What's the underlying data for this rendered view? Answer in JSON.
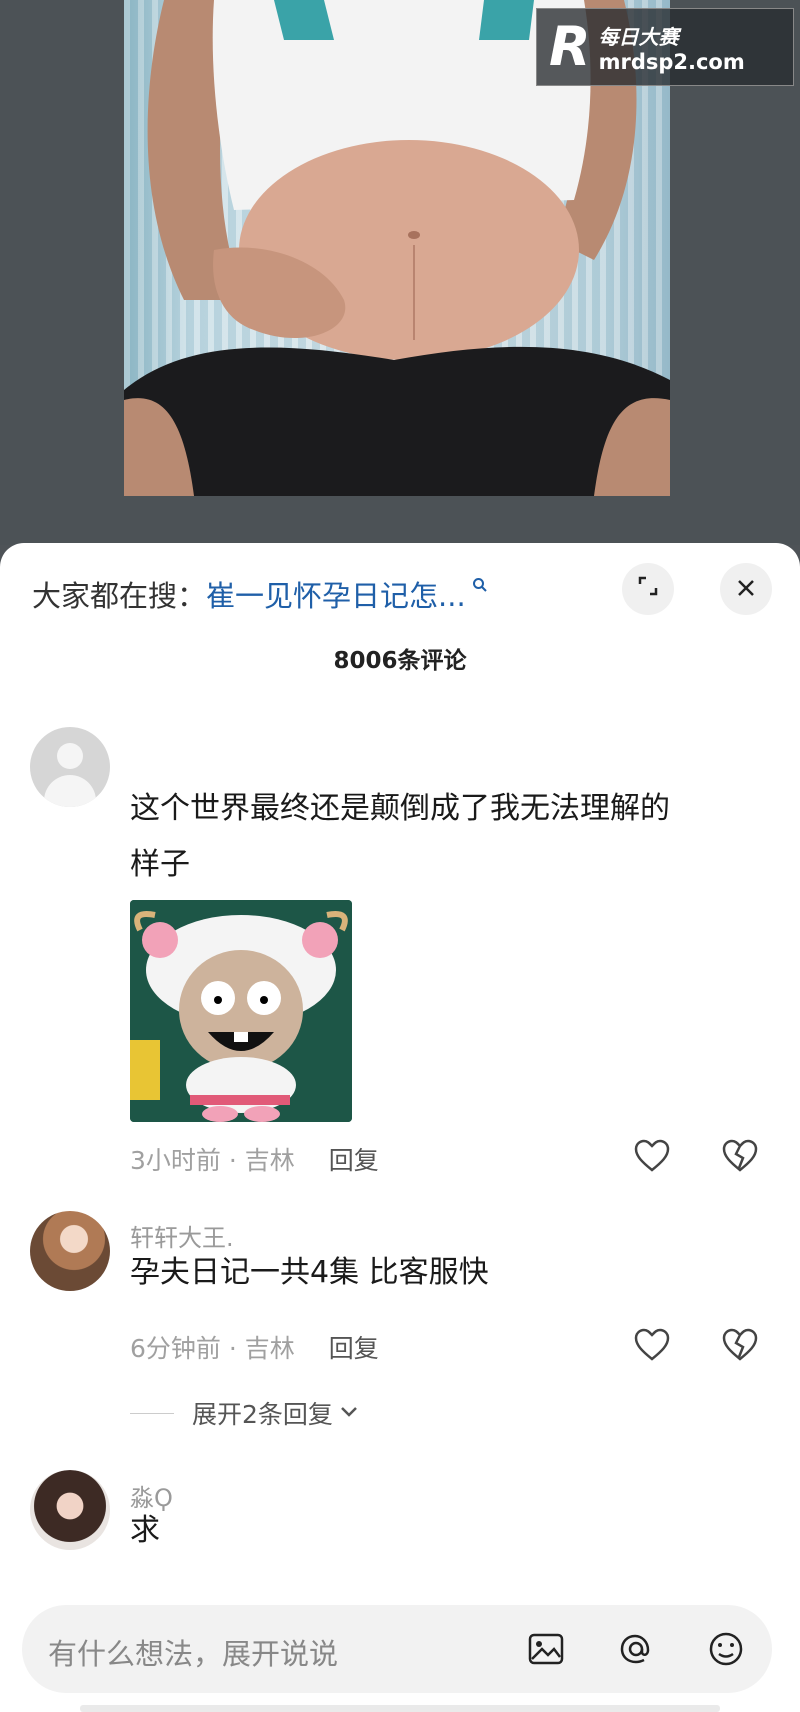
{
  "watermark": {
    "logo_letter": "R",
    "title": "每日大赛",
    "url": "mrdsp2.com"
  },
  "header": {
    "search_prefix": "大家都在搜：",
    "search_query": "崔一见怀孕日记怎...",
    "comment_count": "8006条评论"
  },
  "comments": [
    {
      "username": "",
      "text_line1": "这个世界最终还是颠倒成了我无法理解的",
      "text_line2": "样子",
      "time_location": "3小时前 · 吉林",
      "reply_label": "回复"
    },
    {
      "username": "轩轩大王.",
      "text": "孕夫日记一共4集  比客服快",
      "time_location": "6分钟前 · 吉林",
      "reply_label": "回复",
      "expand_label": "展开2条回复"
    },
    {
      "username": "淼Ϙ",
      "text": "求"
    }
  ],
  "input": {
    "placeholder": "有什么想法，展开说说"
  },
  "icons": {
    "search": "search-icon",
    "expand": "expand-icon",
    "close": "close-icon",
    "like": "heart-icon",
    "dislike": "broken-heart-icon",
    "image": "image-icon",
    "mention": "at-icon",
    "emoji": "emoji-icon"
  },
  "colors": {
    "link": "#1f5fa8",
    "muted": "#a0a0a0",
    "panel_bg": "#ffffff"
  }
}
